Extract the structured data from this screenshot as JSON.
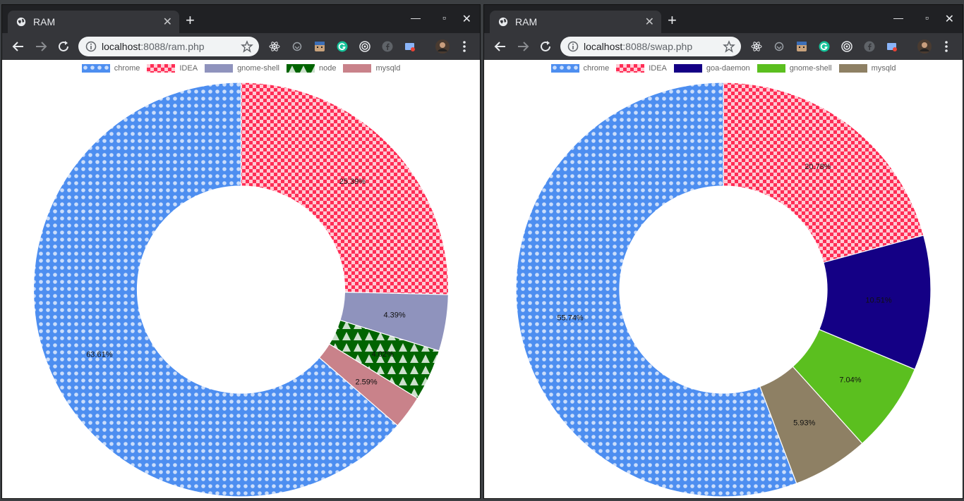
{
  "windows": [
    {
      "tab_title": "RAM",
      "url_host": "localhost",
      "url_rest": ":8088/ram.php",
      "chart_data": {
        "type": "pie",
        "donut": true,
        "legend_position": "top",
        "series": [
          {
            "name": "chrome",
            "value": 63.61,
            "label": "63.61%",
            "color": "#4d8ef0",
            "pattern": "dots"
          },
          {
            "name": "IDEA",
            "value": 25.39,
            "label": "25.39%",
            "color": "#ff2d55",
            "pattern": "checker"
          },
          {
            "name": "gnome-shell",
            "value": 4.39,
            "label": "4.39%",
            "color": "#8f93bd",
            "pattern": "solid"
          },
          {
            "name": "node",
            "value": 4.02,
            "label": "4.02%",
            "color": "#006400",
            "pattern": "triangles"
          },
          {
            "name": "mysqld",
            "value": 2.59,
            "label": "2.59%",
            "color": "#c9828a",
            "pattern": "solid"
          }
        ],
        "legend_order": [
          "chrome",
          "IDEA",
          "gnome-shell",
          "node",
          "mysqld"
        ]
      }
    },
    {
      "tab_title": "RAM",
      "url_host": "localhost",
      "url_rest": ":8088/swap.php",
      "chart_data": {
        "type": "pie",
        "donut": true,
        "legend_position": "top",
        "series": [
          {
            "name": "chrome",
            "value": 55.74,
            "label": "55.74%",
            "color": "#4d8ef0",
            "pattern": "dots"
          },
          {
            "name": "IDEA",
            "value": 20.78,
            "label": "20.78%",
            "color": "#ff2d55",
            "pattern": "checker"
          },
          {
            "name": "goa-daemon",
            "value": 10.51,
            "label": "10.51%",
            "color": "#140085",
            "pattern": "solid"
          },
          {
            "name": "gnome-shell",
            "value": 7.04,
            "label": "7.04%",
            "color": "#5bbf1f",
            "pattern": "solid"
          },
          {
            "name": "mysqld",
            "value": 5.93,
            "label": "5.93%",
            "color": "#8e8064",
            "pattern": "solid"
          }
        ],
        "legend_order": [
          "chrome",
          "IDEA",
          "goa-daemon",
          "gnome-shell",
          "mysqld"
        ]
      }
    }
  ]
}
